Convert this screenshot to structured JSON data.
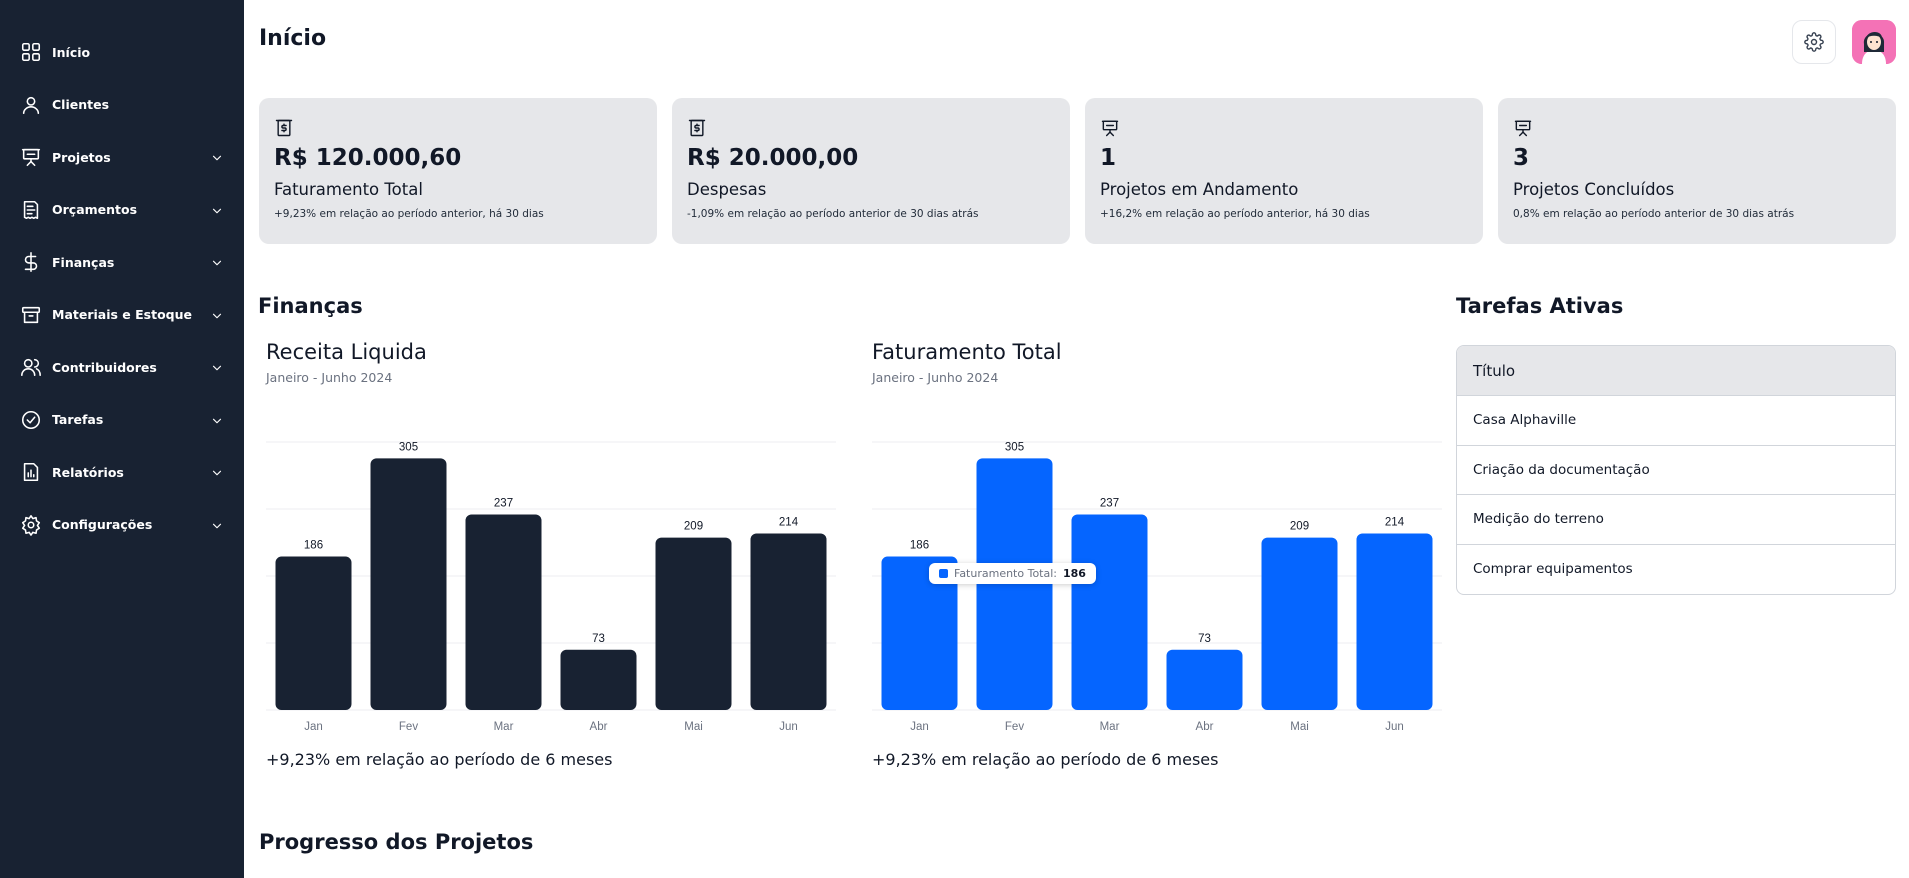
{
  "sidebar": {
    "items": [
      {
        "label": "Início",
        "icon": "grid-icon",
        "has_chevron": false
      },
      {
        "label": "Clientes",
        "icon": "user-icon",
        "has_chevron": false
      },
      {
        "label": "Projetos",
        "icon": "presentation-icon",
        "has_chevron": true
      },
      {
        "label": "Orçamentos",
        "icon": "receipt-icon",
        "has_chevron": true
      },
      {
        "label": "Finanças",
        "icon": "dollar-icon",
        "has_chevron": true
      },
      {
        "label": "Materiais e Estoque",
        "icon": "archive-icon",
        "has_chevron": true
      },
      {
        "label": "Contribuidores",
        "icon": "users-icon",
        "has_chevron": true
      },
      {
        "label": "Tarefas",
        "icon": "check-circle-icon",
        "has_chevron": true
      },
      {
        "label": "Relatórios",
        "icon": "report-icon",
        "has_chevron": true
      },
      {
        "label": "Configurações",
        "icon": "gear-icon",
        "has_chevron": true
      }
    ]
  },
  "header": {
    "title": "Início"
  },
  "cards": [
    {
      "icon": "money-icon",
      "value": "R$ 120.000,60",
      "label": "Faturamento Total",
      "note": "+9,23% em relação ao período anterior, há 30 dias"
    },
    {
      "icon": "money-icon",
      "value": "R$ 20.000,00",
      "label": "Despesas",
      "note": "-1,09% em relação ao período anterior de 30 dias atrás"
    },
    {
      "icon": "presentation-icon",
      "value": "1",
      "label": "Projetos em Andamento",
      "note": "+16,2% em relação ao período anterior, há 30 dias"
    },
    {
      "icon": "presentation-icon",
      "value": "3",
      "label": "Projetos Concluídos",
      "note": "0,8% em relação ao período anterior de 30 dias atrás"
    }
  ],
  "sections": {
    "financas": "Finanças",
    "tarefas": "Tarefas Ativas",
    "progresso": "Progresso dos Projetos"
  },
  "charts": [
    {
      "title": "Receita Liquida",
      "subtitle": "Janeiro - Junho 2024",
      "footer": "+9,23% em relação ao período de 6 meses",
      "color": "#182232"
    },
    {
      "title": "Faturamento Total",
      "subtitle": "Janeiro - Junho 2024",
      "footer": "+9,23% em relação ao período de 6 meses",
      "color": "#0565ff",
      "tooltip": {
        "label": "Faturamento Total:",
        "value": "186"
      }
    }
  ],
  "chart_data": [
    {
      "type": "bar",
      "title": "Receita Liquida",
      "subtitle": "Janeiro - Junho 2024",
      "categories": [
        "Jan",
        "Fev",
        "Mar",
        "Abr",
        "Mai",
        "Jun"
      ],
      "values": [
        186,
        305,
        237,
        73,
        209,
        214
      ],
      "ylim": [
        0,
        320
      ],
      "grid": true
    },
    {
      "type": "bar",
      "title": "Faturamento Total",
      "subtitle": "Janeiro - Junho 2024",
      "categories": [
        "Jan",
        "Fev",
        "Mar",
        "Abr",
        "Mai",
        "Jun"
      ],
      "values": [
        186,
        305,
        237,
        73,
        209,
        214
      ],
      "ylim": [
        0,
        320
      ],
      "grid": true
    }
  ],
  "tasks": {
    "header": "Título",
    "rows": [
      "Casa Alphaville",
      "Criação da documentação",
      "Medição do terreno",
      "Comprar equipamentos"
    ]
  }
}
